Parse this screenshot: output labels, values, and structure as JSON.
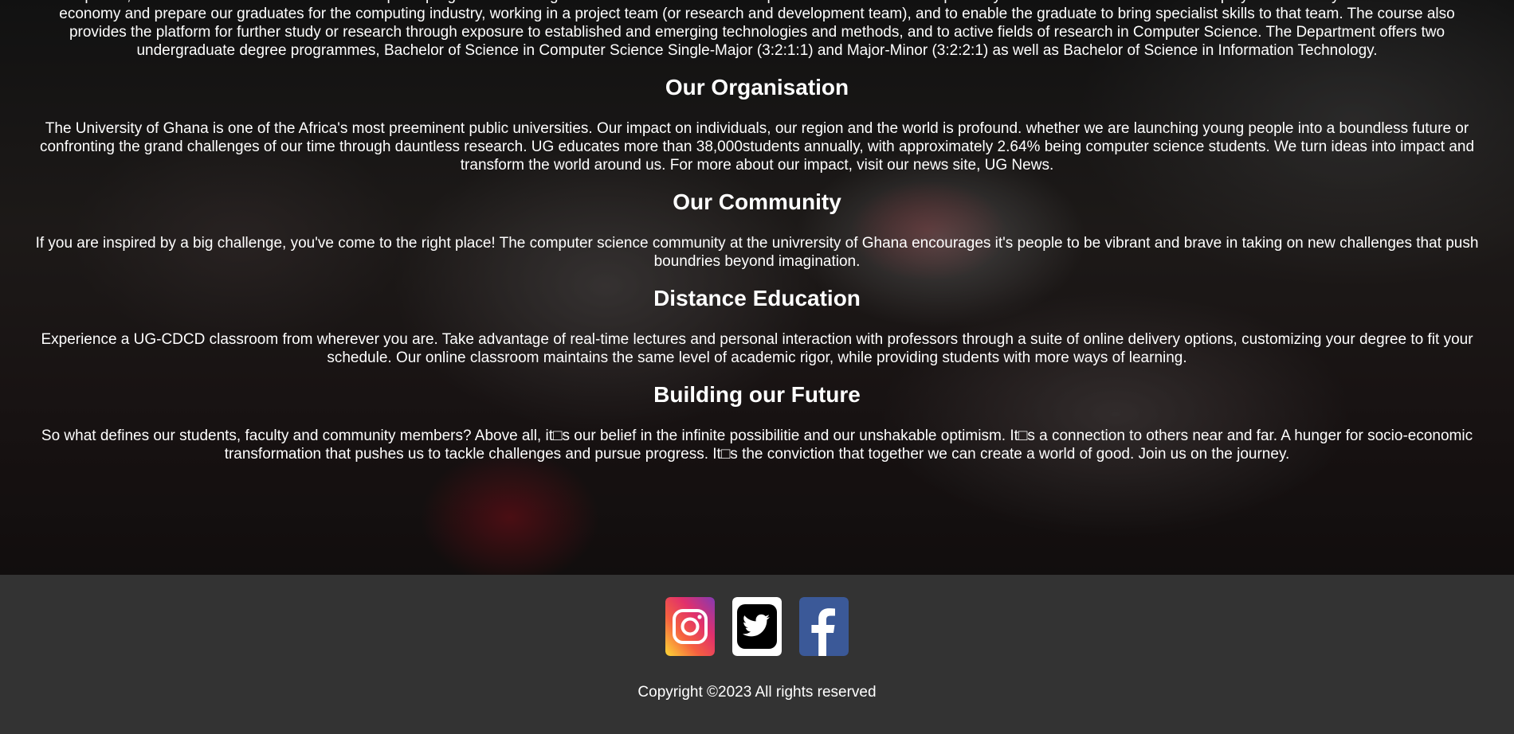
{
  "intro": {
    "text": "development, construction and maintenance of computer programs. The range of courses available in the department and the skills acquired by students enable them to find employment in many diverse fields of the economy and prepare our graduates for the computing industry, working in a project team (or research and development team), and to enable the graduate to bring specialist skills to that team. The course also provides the platform for further study or research through exposure to established and emerging technologies and methods, and to active fields of research in Computer Science. The Department offers two undergraduate degree programmes, Bachelor of Science in Computer Science Single-Major (3:2:1:1) and Major-Minor (3:2:2:1) as well as Bachelor of Science in Information Technology."
  },
  "sections": [
    {
      "title": "Our Organisation",
      "text": "The University of Ghana is one of the Africa's most preeminent public universities. Our impact on individuals, our region and the world is profound. whether we are launching young people into a boundless future or confronting the grand challenges of our time through dauntless research. UG educates more than 38,000students annually, with approximately 2.64% being computer science students. We turn ideas into impact and transform the world around us. For more about our impact, visit our news site, UG News."
    },
    {
      "title": "Our Community",
      "text": "If you are inspired by a big challenge, you've come to the right place! The computer science community at the univrersity of Ghana encourages it's people to be vibrant and brave in taking on new challenges that push boundries beyond imagination."
    },
    {
      "title": "Distance Education",
      "text": "Experience a UG-CDCD classroom from wherever you are. Take advantage of real-time lectures and personal interaction with professors through a suite of online delivery options, customizing your degree to fit your schedule. Our online classroom maintains the same level of academic rigor, while providing students with more ways of learning."
    },
    {
      "title": "Building our Future",
      "text": "So what defines our students, faculty and community members? Above all, it□s our belief in the infinite possibilitie and our unshakable optimism. It□s a connection to others near and far. A hunger for socio-economic transformation that pushes us to tackle challenges and pursue progress. It□s the conviction that together we can create a world of good. Join us on the journey."
    }
  ],
  "footer": {
    "social": [
      {
        "name": "instagram-icon",
        "color": "#e1306c"
      },
      {
        "name": "twitter-icon",
        "color": "#000000"
      },
      {
        "name": "facebook-icon",
        "color": "#3b5998"
      }
    ],
    "copyright": "Copyright ©2023 All rights reserved"
  }
}
